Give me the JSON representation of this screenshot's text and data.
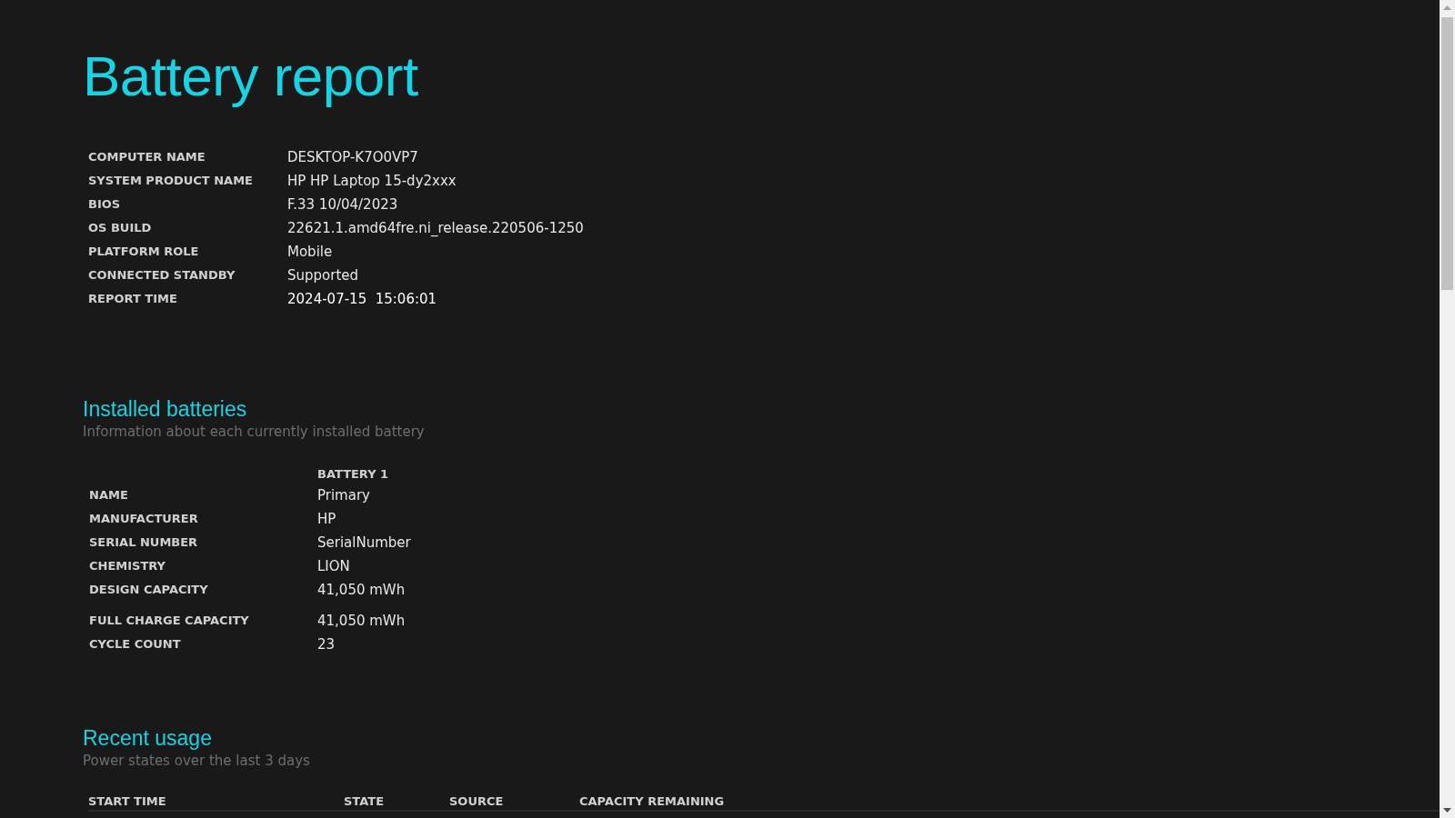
{
  "title": "Battery report",
  "system_info": [
    {
      "label": "COMPUTER NAME",
      "value": "DESKTOP-K7O0VP7"
    },
    {
      "label": "SYSTEM PRODUCT NAME",
      "value": "HP HP Laptop 15-dy2xxx"
    },
    {
      "label": "BIOS",
      "value": "F.33 10/04/2023"
    },
    {
      "label": "OS BUILD",
      "value": "22621.1.amd64fre.ni_release.220506-1250"
    },
    {
      "label": "PLATFORM ROLE",
      "value": "Mobile"
    },
    {
      "label": "CONNECTED STANDBY",
      "value": "Supported"
    },
    {
      "label": "REPORT TIME",
      "value": "2024-07-15  15:06:01"
    }
  ],
  "installed_batteries": {
    "heading": "Installed batteries",
    "subtitle": "Information about each currently installed battery",
    "column_header": "BATTERY 1",
    "rows": [
      {
        "label": "NAME",
        "value": "Primary"
      },
      {
        "label": "MANUFACTURER",
        "value": "HP"
      },
      {
        "label": "SERIAL NUMBER",
        "value": "SerialNumber"
      },
      {
        "label": "CHEMISTRY",
        "value": "LION"
      },
      {
        "label": "DESIGN CAPACITY",
        "value": "41,050 mWh"
      },
      {
        "label": "FULL CHARGE CAPACITY",
        "value": "41,050 mWh"
      },
      {
        "label": "CYCLE COUNT",
        "value": "23"
      }
    ]
  },
  "recent_usage": {
    "heading": "Recent usage",
    "subtitle": "Power states over the last 3 days",
    "columns": [
      "START TIME",
      "STATE",
      "SOURCE",
      "CAPACITY REMAINING"
    ]
  }
}
